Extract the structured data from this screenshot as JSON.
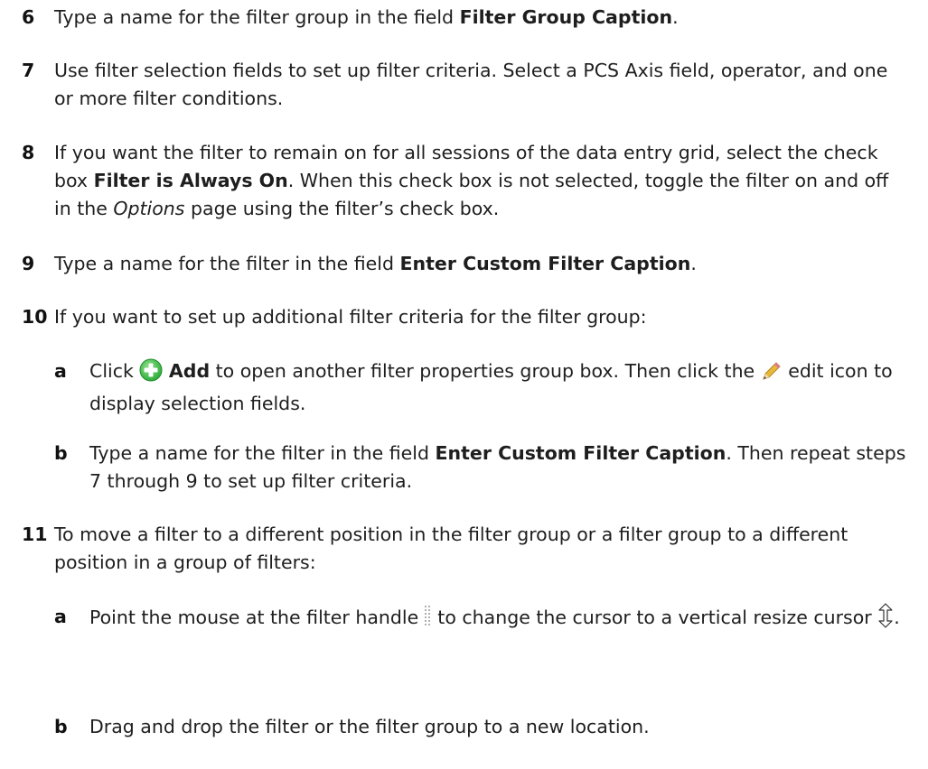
{
  "steps": [
    {
      "n": "6",
      "t1": "Type a name for the filter group in the field ",
      "b1": "Filter Group Caption",
      "t2": "."
    },
    {
      "n": "7",
      "t1": "Use filter selection fields to set up filter criteria. Select a PCS Axis field, operator, and one or more filter conditions."
    },
    {
      "n": "8",
      "t1": "If you want the filter to remain on for all sessions of the data entry grid, select the check box ",
      "b1": "Filter is Always On",
      "t2": ". When this check box is not selected, toggle the filter on and off in the ",
      "i1": "Options",
      "t3": " page using the filter’s check box."
    },
    {
      "n": "9",
      "t1": "Type a name for the filter in the field ",
      "b1": "Enter Custom Filter Caption",
      "t2": "."
    },
    {
      "n": "10",
      "t1": "If you want to set up additional filter criteria for the filter group:",
      "subs": [
        {
          "n": "a",
          "t1": "Click ",
          "b1": "Add",
          "t2": " to open another filter properties group box. Then click the ",
          "t3": " edit icon to display selection fields."
        },
        {
          "n": "b",
          "t1": "Type a name for the filter in the field ",
          "b1": "Enter Custom Filter Caption",
          "t2": ". Then repeat steps 7 through 9 to set up filter criteria."
        }
      ]
    },
    {
      "n": "11",
      "t1": "To move a filter to a different position in the filter group or a filter group to a different position in a group of filters:",
      "subs": [
        {
          "n": "a",
          "t1": "Point the mouse at the filter handle ",
          "t2": " to change the cursor to a vertical resize cursor ",
          "t3": "."
        },
        {
          "n": "b",
          "t1": "Drag and drop the filter or the filter group to a new location."
        }
      ]
    }
  ],
  "icons": {
    "add": "add-icon",
    "edit": "pencil-edit-icon",
    "handle": "drag-handle-icon",
    "cursor": "vertical-resize-cursor-icon"
  },
  "colors": {
    "add_green": "#2fae3a",
    "pencil_yellow": "#e6b93a",
    "text": "#1e1e1e"
  }
}
